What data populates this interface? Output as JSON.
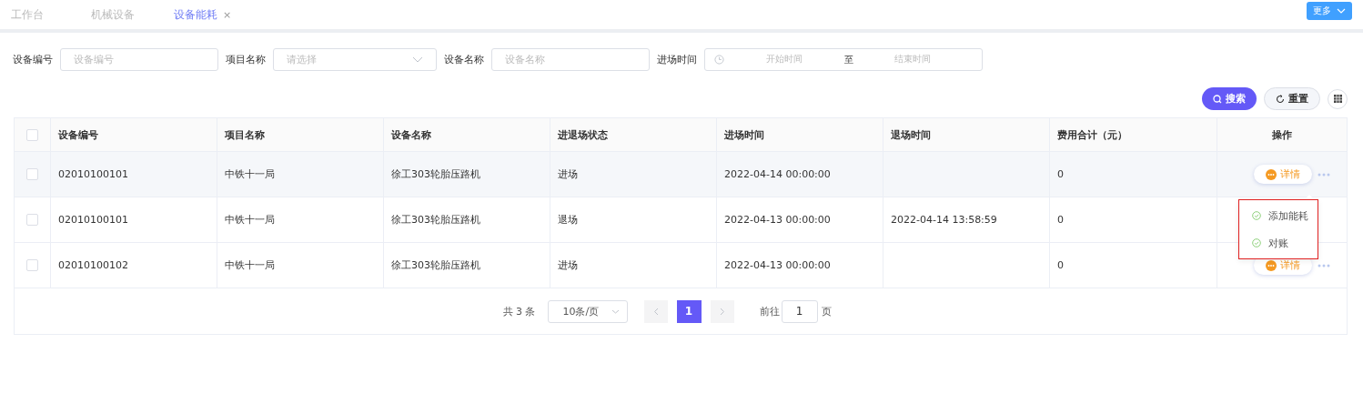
{
  "tabs": [
    {
      "label": "工作台",
      "selected": false,
      "closable": false
    },
    {
      "label": "机械设备",
      "selected": false,
      "closable": false
    },
    {
      "label": "设备能耗",
      "selected": true,
      "closable": true
    }
  ],
  "close_glyph": "×",
  "more_button": "更多",
  "filters": [
    {
      "label": "设备编号",
      "kind": "text",
      "placeholder": "设备编号"
    },
    {
      "label": "项目名称",
      "kind": "select",
      "placeholder": "请选择"
    },
    {
      "label": "设备名称",
      "kind": "text",
      "placeholder": "设备名称"
    },
    {
      "label": "进场时间",
      "kind": "daterange",
      "start_placeholder": "开始时间",
      "separator": "至",
      "end_placeholder": "结束时间"
    }
  ],
  "search_button": "搜索",
  "reset_button": "重置",
  "table": {
    "all_selected": false,
    "columns": [
      "设备编号",
      "项目名称",
      "设备名称",
      "进退场状态",
      "进场时间",
      "退场时间",
      "费用合计（元）",
      "操作"
    ],
    "rows": [
      {
        "selected": false,
        "cells": [
          "02010100101",
          "中铁十一局",
          "徐工303轮胎压路机",
          "进场",
          "2022-04-14 00:00:00",
          "",
          "0"
        ],
        "action": "详情"
      },
      {
        "selected": false,
        "cells": [
          "02010100101",
          "中铁十一局",
          "徐工303轮胎压路机",
          "退场",
          "2022-04-13 00:00:00",
          "2022-04-14 13:58:59",
          "0"
        ]
      },
      {
        "selected": false,
        "cells": [
          "02010100102",
          "中铁十一局",
          "徐工303轮胎压路机",
          "进场",
          "2022-04-13 00:00:00",
          "",
          "0"
        ],
        "action": "详情"
      }
    ]
  },
  "dropdown_menu": [
    "添加能耗",
    "对账"
  ],
  "pagination": {
    "total": "共 3 条",
    "page_size": "10条/页",
    "pages": [
      {
        "label": "1",
        "selected": true
      }
    ],
    "goto_label": "前往",
    "goto_value": "1",
    "goto_suffix": "页"
  }
}
